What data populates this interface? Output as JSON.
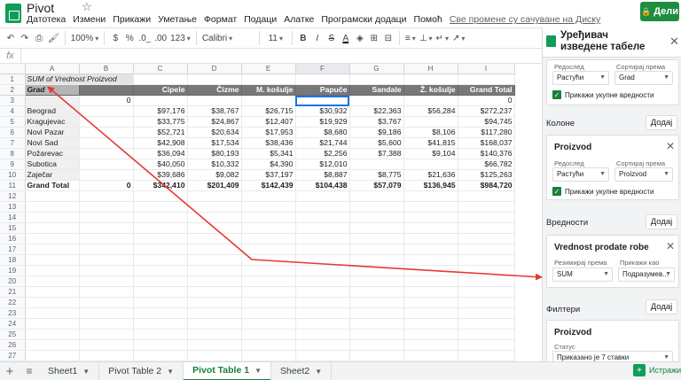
{
  "app": {
    "title": "Pivot",
    "share_label": "Дели",
    "menu": [
      "Датотека",
      "Измени",
      "Прикажи",
      "Уметање",
      "Формат",
      "Подаци",
      "Алатке",
      "Програмски додаци",
      "Помоћ"
    ],
    "save_status": "Све промене су сачуване на Диску"
  },
  "toolbar": {
    "zoom": "100%",
    "currency": "$",
    "percent": "%",
    "dec_decrease": ".0_",
    "dec_increase": ".00",
    "number_format": "123",
    "font": "Calibri",
    "font_size": "11",
    "bold": "B",
    "italic": "I",
    "strike": "S",
    "text_color": "A"
  },
  "formula_bar": {
    "fx": "fx",
    "value": ""
  },
  "grid": {
    "columns": [
      "A",
      "B",
      "C",
      "D",
      "E",
      "F",
      "G",
      "H",
      "I"
    ],
    "selected_column": "F",
    "row_numbers": [
      "1",
      "2",
      "3",
      "4",
      "5",
      "6",
      "7",
      "8",
      "9",
      "10",
      "11",
      "12",
      "13",
      "14",
      "15",
      "16",
      "17",
      "18",
      "19",
      "20",
      "21",
      "22",
      "23",
      "24",
      "25",
      "26",
      "27"
    ],
    "pivot_title": "SUM of Vrednost Proizvod",
    "row_label_header": "Grad",
    "headers": [
      "",
      "Cipele",
      "Čizme",
      "M. košulje",
      "Papuče",
      "Sandale",
      "Ž. košulje",
      "Grand Total"
    ],
    "blank_row": [
      "",
      "0",
      "",
      "",
      "",
      "",
      "",
      "",
      "0"
    ],
    "rows": [
      [
        "Beograd",
        "",
        "$97,176",
        "$38,767",
        "$26,715",
        "$30,932",
        "$22,363",
        "$56,284",
        "$272,237"
      ],
      [
        "Kragujevac",
        "",
        "$33,775",
        "$24,867",
        "$12,407",
        "$19,929",
        "$3,767",
        "",
        "$94,745"
      ],
      [
        "Novi Pazar",
        "",
        "$52,721",
        "$20,634",
        "$17,953",
        "$8,680",
        "$9,186",
        "$8,106",
        "$117,280"
      ],
      [
        "Novi Sad",
        "",
        "$42,908",
        "$17,534",
        "$38,436",
        "$21,744",
        "$5,600",
        "$41,815",
        "$168,037"
      ],
      [
        "Požarevac",
        "",
        "$36,094",
        "$80,193",
        "$5,341",
        "$2,256",
        "$7,388",
        "$9,104",
        "$140,376"
      ],
      [
        "Subotica",
        "",
        "$40,050",
        "$10,332",
        "$4,390",
        "$12,010",
        "",
        "",
        "$66,782"
      ],
      [
        "Zaječar",
        "",
        "$39,686",
        "$9,082",
        "$37,197",
        "$8,887",
        "$8,775",
        "$21,636",
        "$125,263"
      ]
    ],
    "total_row": [
      "Grand Total",
      "0",
      "$342,410",
      "$201,409",
      "$142,439",
      "$104,438",
      "$57,079",
      "$136,945",
      "$984,720"
    ]
  },
  "sheet_tabs": [
    {
      "label": "Sheet1",
      "active": false
    },
    {
      "label": "Pivot Table 2",
      "active": false
    },
    {
      "label": "Pivot Table 1",
      "active": true
    },
    {
      "label": "Sheet2",
      "active": false
    }
  ],
  "explore_label": "Истражи",
  "panel": {
    "title": "Уређивач изведене табеле",
    "rows_card": {
      "order_label": "Редослед",
      "order_value": "Растући",
      "sort_label": "Сортирај према",
      "sort_value": "Grad",
      "show_totals": "Прикажи укупне вредности"
    },
    "columns_section": {
      "title": "Колоне",
      "add": "Додај",
      "card_name": "Proizvod",
      "order_label": "Редослед",
      "order_value": "Растући",
      "sort_label": "Сортирај према",
      "sort_value": "Proizvod",
      "show_totals": "Прикажи укупне вредности"
    },
    "values_section": {
      "title": "Вредности",
      "add": "Додај",
      "card_name": "Vrednost prodate robe",
      "summarize_label": "Резимирај према",
      "summarize_value": "SUM",
      "show_as_label": "Прикажи као",
      "show_as_value": "Подразумев..."
    },
    "filters_section": {
      "title": "Филтери",
      "add": "Додај",
      "card_name": "Proizvod",
      "status_label": "Статус",
      "status_value": "Приказано је 7 ставки"
    }
  },
  "colors": {
    "accent_green": "#188038",
    "arrow_red": "#e53935",
    "selection_blue": "#1a73e8"
  }
}
